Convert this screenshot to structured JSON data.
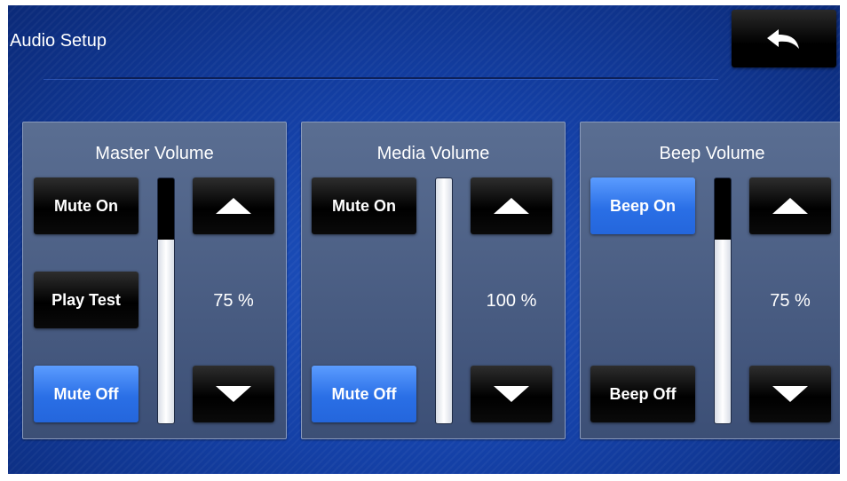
{
  "header": {
    "title": "Audio Setup",
    "back_icon": "back-arrow-icon"
  },
  "panels": [
    {
      "title": "Master Volume",
      "level_percent": 75,
      "level_text": "75 %",
      "top_button": "Mute On",
      "middle_button": "Play Test",
      "bottom_button": "Mute Off",
      "active_button": "bottom"
    },
    {
      "title": "Media Volume",
      "level_percent": 100,
      "level_text": "100 %",
      "top_button": "Mute On",
      "bottom_button": "Mute Off",
      "active_button": "bottom"
    },
    {
      "title": "Beep Volume",
      "level_percent": 75,
      "level_text": "75 %",
      "top_button": "Beep On",
      "bottom_button": "Beep Off",
      "active_button": "top"
    }
  ],
  "colors": {
    "background": "#1440a6",
    "panel": "#4b5d84",
    "button_dark": "#000000",
    "button_active": "#2a6fe6"
  }
}
